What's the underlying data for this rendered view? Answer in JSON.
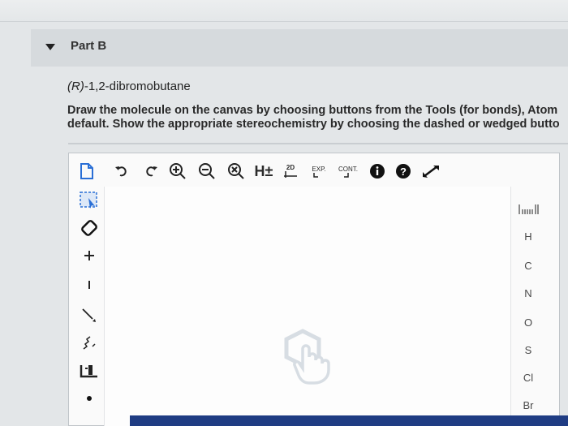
{
  "part": {
    "title": "Part B"
  },
  "question": {
    "name_prefix": "(R)",
    "name_suffix": "-1,2-dibromobutane",
    "line1": "Draw the molecule on the canvas by choosing buttons from the Tools (for bonds), Atom",
    "line2": "default. Show the appropriate stereochemistry by choosing the dashed or wedged butto"
  },
  "toolbar": {
    "items": [
      "new-document-icon",
      "undo-icon",
      "redo-icon",
      "zoom-in-icon",
      "zoom-out-icon",
      "zoom-reset-icon",
      "explicit-hydrogen-icon",
      "2d-clean-icon",
      "expand-icon",
      "contract-icon",
      "info-icon",
      "help-icon",
      "fullscreen-icon"
    ],
    "h_label": "H±",
    "twod_label": "2D",
    "exp_label": "EXP.",
    "cont_label": "CONT."
  },
  "left_tools": [
    "select-icon",
    "eraser-icon",
    "positive-charge-icon",
    "negative-charge-icon",
    "single-bond-icon",
    "wavy-bond-icon",
    "template-icon",
    "radical-icon"
  ],
  "atoms": [
    "H",
    "C",
    "N",
    "O",
    "S",
    "Cl",
    "Br"
  ],
  "periodic_icon": "periodic-table-icon",
  "colors": {
    "accent_bottom": "#1f3c83",
    "header_bg": "#d6dadd"
  }
}
